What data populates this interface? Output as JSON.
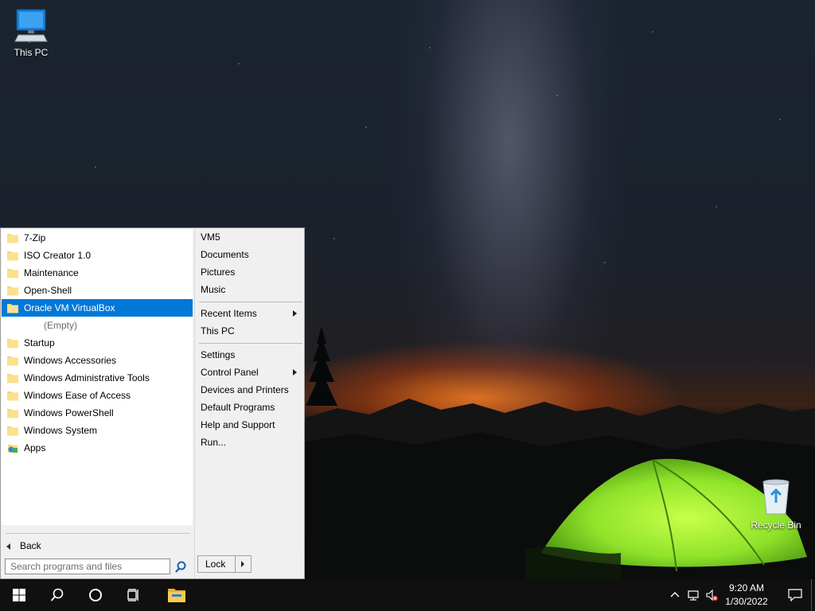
{
  "desktop": {
    "icons": [
      {
        "label": "This PC",
        "icon": "computer-icon"
      },
      {
        "label": "Recycle Bin",
        "icon": "recycle-bin-icon"
      }
    ]
  },
  "start_menu": {
    "programs": [
      {
        "label": "7-Zip",
        "icon": "folder-icon"
      },
      {
        "label": "ISO Creator 1.0",
        "icon": "folder-icon"
      },
      {
        "label": "Maintenance",
        "icon": "folder-icon"
      },
      {
        "label": "Open-Shell",
        "icon": "folder-icon"
      },
      {
        "label": "Oracle VM VirtualBox",
        "icon": "folder-icon",
        "selected": true
      },
      {
        "label": "Startup",
        "icon": "folder-icon"
      },
      {
        "label": "Windows Accessories",
        "icon": "folder-icon"
      },
      {
        "label": "Windows Administrative Tools",
        "icon": "folder-icon"
      },
      {
        "label": "Windows Ease of Access",
        "icon": "folder-icon"
      },
      {
        "label": "Windows PowerShell",
        "icon": "folder-icon"
      },
      {
        "label": "Windows System",
        "icon": "folder-icon"
      },
      {
        "label": "Apps",
        "icon": "apps-icon"
      }
    ],
    "empty_label": "(Empty)",
    "back_label": "Back",
    "search": {
      "placeholder": "Search programs and files",
      "value": ""
    },
    "right_items": [
      {
        "label": "VM5"
      },
      {
        "label": "Documents"
      },
      {
        "label": "Pictures"
      },
      {
        "label": "Music"
      },
      {
        "label": "Recent Items",
        "submenu": true
      },
      {
        "label": "This PC"
      },
      {
        "label": "Settings"
      },
      {
        "label": "Control Panel",
        "submenu": true
      },
      {
        "label": "Devices and Printers"
      },
      {
        "label": "Default Programs"
      },
      {
        "label": "Help and Support"
      },
      {
        "label": "Run..."
      }
    ],
    "lock_label": "Lock"
  },
  "taskbar": {
    "buttons": [
      "windows-start-icon",
      "search-icon",
      "cortana-icon",
      "task-view-icon",
      "file-explorer-icon"
    ],
    "tray": [
      "chevron-up-icon",
      "network-icon",
      "volume-muted-icon"
    ],
    "clock": {
      "time": "9:20 AM",
      "date": "1/30/2022"
    }
  },
  "colors": {
    "selection": "#0078d7",
    "taskbar": "#101010",
    "menu_bg": "#f0f0f0"
  }
}
